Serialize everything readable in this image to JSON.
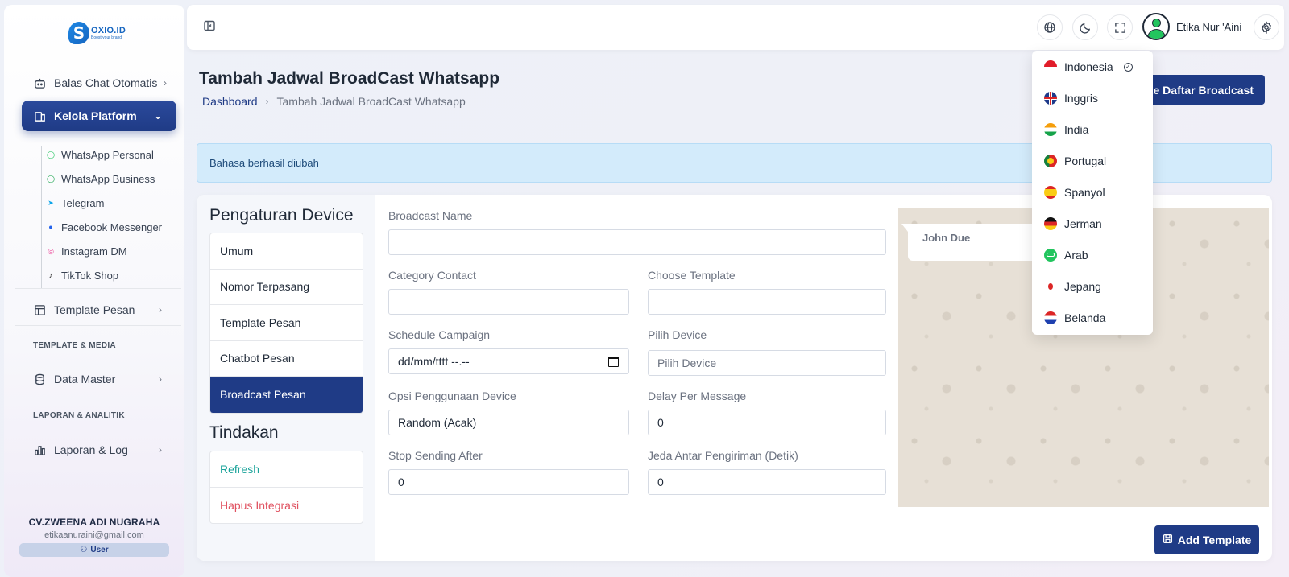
{
  "brand": {
    "name": "OXIO.ID",
    "tagline": "Boost your brand"
  },
  "sidebar": {
    "items": [
      {
        "label": "Balas Chat Otomatis"
      },
      {
        "label": "Kelola Platform"
      },
      {
        "label": "Template Pesan"
      },
      {
        "label": "Data Master"
      },
      {
        "label": "Laporan & Log"
      }
    ],
    "sub_items": [
      {
        "label": "WhatsApp Personal"
      },
      {
        "label": "WhatsApp Business"
      },
      {
        "label": "Telegram"
      },
      {
        "label": "Facebook Messenger"
      },
      {
        "label": "Instagram DM"
      },
      {
        "label": "TikTok Shop"
      }
    ],
    "sections": [
      "TEMPLATE & MEDIA",
      "LAPORAN & ANALITIK"
    ],
    "user": {
      "company": "CV.ZWEENA ADI NUGRAHA",
      "email": "etikaanuraini@gmail.com",
      "role": "User"
    }
  },
  "topbar": {
    "user_name": "Etika Nur 'Aini"
  },
  "page": {
    "title": "Tambah Jadwal BroadCast Whatsapp",
    "breadcrumb": {
      "home": "Dashboard",
      "current": "Tambah Jadwal BroadCast Whatsapp"
    },
    "back_button": "Ke Daftar Broadcast",
    "alert": "Bahasa berhasil diubah"
  },
  "settings_pane": {
    "title": "Pengaturan Device",
    "menu": [
      "Umum",
      "Nomor Terpasang",
      "Template Pesan",
      "Chatbot Pesan",
      "Broadcast Pesan"
    ],
    "actions_title": "Tindakan",
    "actions": [
      "Refresh",
      "Hapus Integrasi"
    ]
  },
  "form": {
    "broadcast_name": {
      "label": "Broadcast Name",
      "value": ""
    },
    "category_contact": {
      "label": "Category Contact",
      "value": ""
    },
    "choose_template": {
      "label": "Choose Template",
      "value": ""
    },
    "schedule_campaign": {
      "label": "Schedule Campaign",
      "value": "dd/mm/tttt --.--"
    },
    "pilih_device": {
      "label": "Pilih Device",
      "placeholder": "Pilih Device"
    },
    "opsi_device": {
      "label": "Opsi Penggunaan Device",
      "value": "Random (Acak)"
    },
    "delay": {
      "label": "Delay Per Message",
      "value": "0"
    },
    "stop_after": {
      "label": "Stop Sending After",
      "value": "0"
    },
    "jeda": {
      "label": "Jeda Antar Pengiriman (Detik)",
      "value": "0"
    },
    "submit": "Add Template"
  },
  "preview": {
    "contact_name": "John Due"
  },
  "language_menu": {
    "selected": "Indonesia",
    "options": [
      "Indonesia",
      "Inggris",
      "India",
      "Portugal",
      "Spanyol",
      "Jerman",
      "Arab",
      "Jepang",
      "Belanda"
    ]
  },
  "colors": {
    "primary": "#1f3b86",
    "alert_bg": "#d3ebfb",
    "refresh": "#1aa39a",
    "danger": "#e05261"
  }
}
